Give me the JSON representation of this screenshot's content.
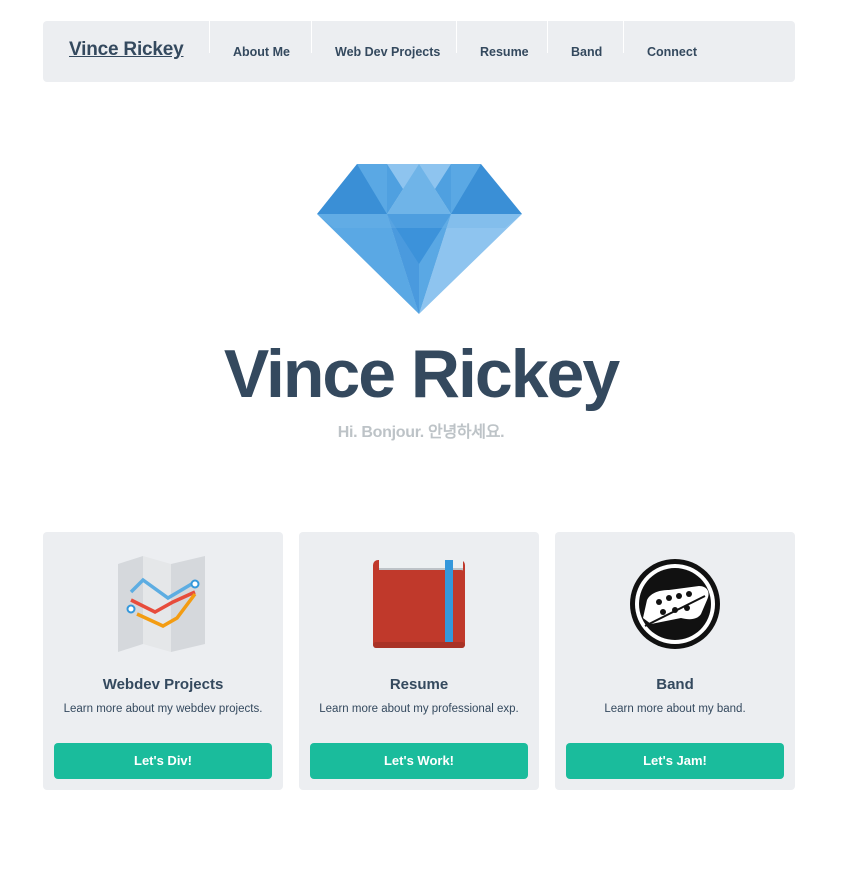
{
  "nav": {
    "brand": "Vince Rickey",
    "links": [
      "About Me",
      "Web Dev Projects",
      "Resume",
      "Band",
      "Connect"
    ]
  },
  "hero": {
    "title": "Vince Rickey",
    "subtitle": "Hi. Bonjour. 안녕하세요.",
    "logo_icon": "diamond-icon"
  },
  "cards": [
    {
      "icon": "map-icon",
      "title": "Webdev Projects",
      "text": "Learn more about my webdev projects.",
      "button": "Let's Div!"
    },
    {
      "icon": "book-icon",
      "title": "Resume",
      "text": "Learn more about my professional exp.",
      "button": "Let's Work!"
    },
    {
      "icon": "guitar-headstock-icon",
      "title": "Band",
      "text": "Learn more about my band.",
      "button": "Let's Jam!"
    }
  ],
  "colors": {
    "navbar_bg": "#eceef1",
    "text_dark": "#34495e",
    "accent_turquoise": "#1abc9c",
    "subtitle_gray": "#bdc3c7",
    "diamond_blue": "#3498db"
  }
}
